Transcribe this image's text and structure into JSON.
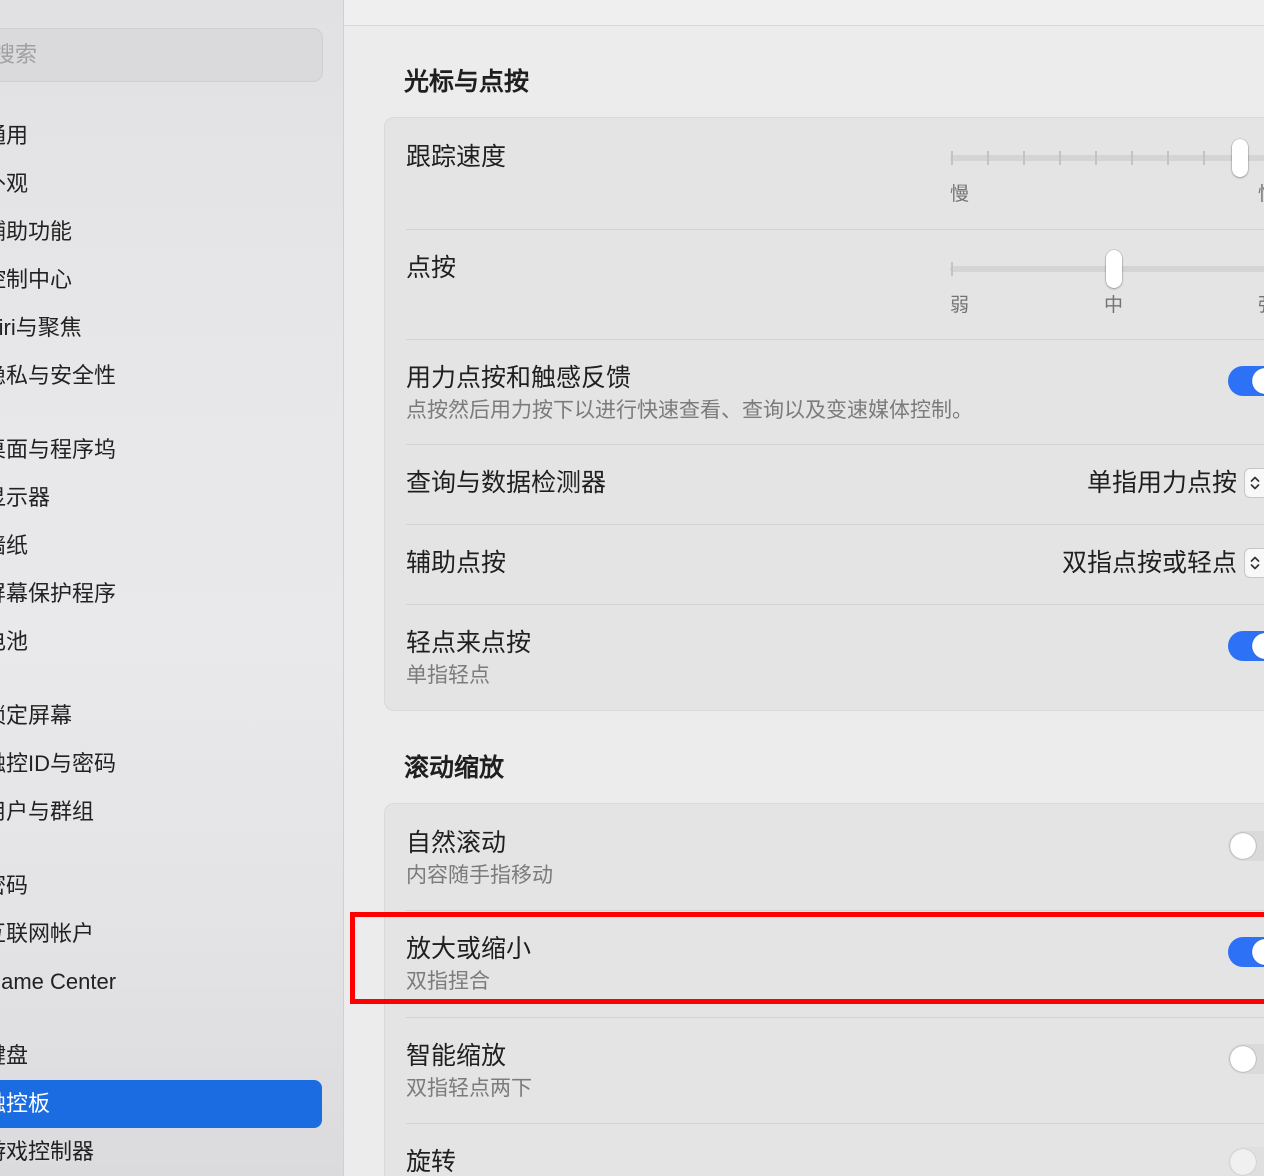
{
  "colors": {
    "accent": "#2d71f6",
    "selection": "#1a6ce0",
    "highlight": "#ff0000"
  },
  "sidebar": {
    "search_placeholder": "搜索",
    "groups": [
      {
        "items": [
          {
            "label": "通用"
          },
          {
            "label": "外观"
          },
          {
            "label": "辅助功能"
          },
          {
            "label": "控制中心"
          },
          {
            "label": "Siri与聚焦"
          },
          {
            "label": "隐私与安全性"
          }
        ]
      },
      {
        "items": [
          {
            "label": "桌面与程序坞"
          },
          {
            "label": "显示器"
          },
          {
            "label": "墙纸"
          },
          {
            "label": "屏幕保护程序"
          },
          {
            "label": "电池"
          }
        ]
      },
      {
        "items": [
          {
            "label": "锁定屏幕"
          },
          {
            "label": "触控ID与密码"
          },
          {
            "label": "用户与群组"
          }
        ]
      },
      {
        "items": [
          {
            "label": "密码"
          },
          {
            "label": "互联网帐户"
          },
          {
            "label": "Game Center"
          }
        ]
      },
      {
        "items": [
          {
            "label": "键盘"
          },
          {
            "label": "触控板",
            "selected": true
          },
          {
            "label": "游戏控制器"
          }
        ]
      }
    ]
  },
  "cursor_click": {
    "title": "光标与点按",
    "tracking_speed": {
      "label": "跟踪速度",
      "min_label": "慢",
      "max_label": "快",
      "value": 0.89
    },
    "click": {
      "label": "点按",
      "labels": [
        "弱",
        "中",
        "强"
      ],
      "value": 0.5
    },
    "force_click": {
      "label": "用力点按和触感反馈",
      "description": "点按然后用力按下以进行快速查看、查询以及变速媒体控制。",
      "on": true
    },
    "lookup": {
      "label": "查询与数据检测器",
      "value": "单指用力点按"
    },
    "secondary_click": {
      "label": "辅助点按",
      "value": "双指点按或轻点"
    },
    "tap_to_click": {
      "label": "轻点来点按",
      "description": "单指轻点",
      "on": true
    }
  },
  "scroll_zoom": {
    "title": "滚动缩放",
    "natural_scrolling": {
      "label": "自然滚动",
      "description": "内容随手指移动",
      "on": false
    },
    "zoom": {
      "label": "放大或缩小",
      "description": "双指捏合",
      "on": true
    },
    "smart_zoom": {
      "label": "智能缩放",
      "description": "双指轻点两下",
      "on": false
    },
    "rotate": {
      "label": "旋转"
    }
  }
}
